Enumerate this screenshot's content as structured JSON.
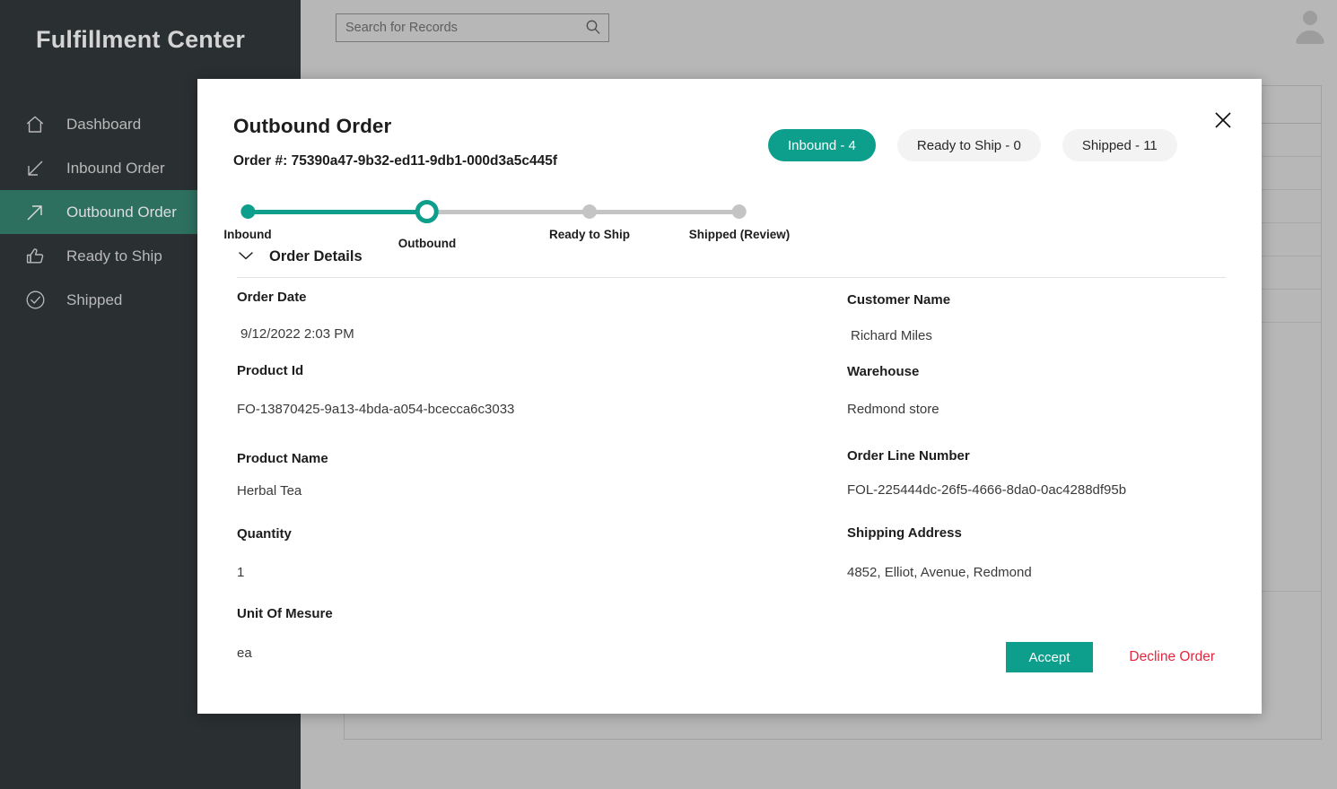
{
  "app": {
    "title": "Fulfillment Center",
    "accent_color": "#0d9e8c",
    "sidebar_bg": "#2a2f31",
    "sidebar_active_bg": "#2d7060",
    "decline_color": "#e2273f"
  },
  "search": {
    "placeholder": "Search for Records",
    "value": "",
    "icon": "search-icon"
  },
  "account": {
    "icon": "user-avatar-icon"
  },
  "sidebar": {
    "items": [
      {
        "label": "Dashboard",
        "icon": "home-icon",
        "active": false
      },
      {
        "label": "Inbound Order",
        "icon": "arrow-down-left-icon",
        "active": false
      },
      {
        "label": "Outbound Order",
        "icon": "arrow-up-right-icon",
        "active": true
      },
      {
        "label": "Ready to Ship",
        "icon": "thumbs-up-icon",
        "active": false
      },
      {
        "label": "Shipped",
        "icon": "check-circle-icon",
        "active": false
      }
    ]
  },
  "modal": {
    "title": "Outbound Order",
    "order_number_label": "Order #: 75390a47-9b32-ed11-9db1-000d3a5c445f",
    "close_icon": "close-icon",
    "pills": [
      {
        "label": "Inbound - 4",
        "active": true
      },
      {
        "label": "Ready to Ship - 0",
        "active": false
      },
      {
        "label": "Shipped - 11",
        "active": false
      }
    ],
    "stepper": {
      "steps": [
        {
          "label": "Inbound",
          "state": "done"
        },
        {
          "label": "Outbound",
          "state": "current"
        },
        {
          "label": "Ready to Ship",
          "state": "pending"
        },
        {
          "label": "Shipped (Review)",
          "state": "pending"
        }
      ]
    },
    "details_section": {
      "label": "Order Details",
      "chevron_icon": "chevron-down-icon",
      "expanded": true
    },
    "fields_left": [
      {
        "label": "Order Date",
        "value": "9/12/2022 2:03 PM"
      },
      {
        "label": "Product Id",
        "value": "FO-13870425-9a13-4bda-a054-bcecca6c3033"
      },
      {
        "label": "Product Name",
        "value": "Herbal Tea"
      },
      {
        "label": "Quantity",
        "value": "1"
      },
      {
        "label": "Unit Of Mesure",
        "value": "ea"
      }
    ],
    "fields_right": [
      {
        "label": "Customer Name",
        "value": "Richard Miles"
      },
      {
        "label": "Warehouse",
        "value": "Redmond store"
      },
      {
        "label": "Order Line Number",
        "value": "FOL-225444dc-26f5-4666-8da0-0ac4288df95b"
      },
      {
        "label": "Shipping Address",
        "value": "4852, Elliot, Avenue, Redmond"
      }
    ],
    "actions": {
      "accept_label": "Accept",
      "decline_label": "Decline Order"
    }
  }
}
